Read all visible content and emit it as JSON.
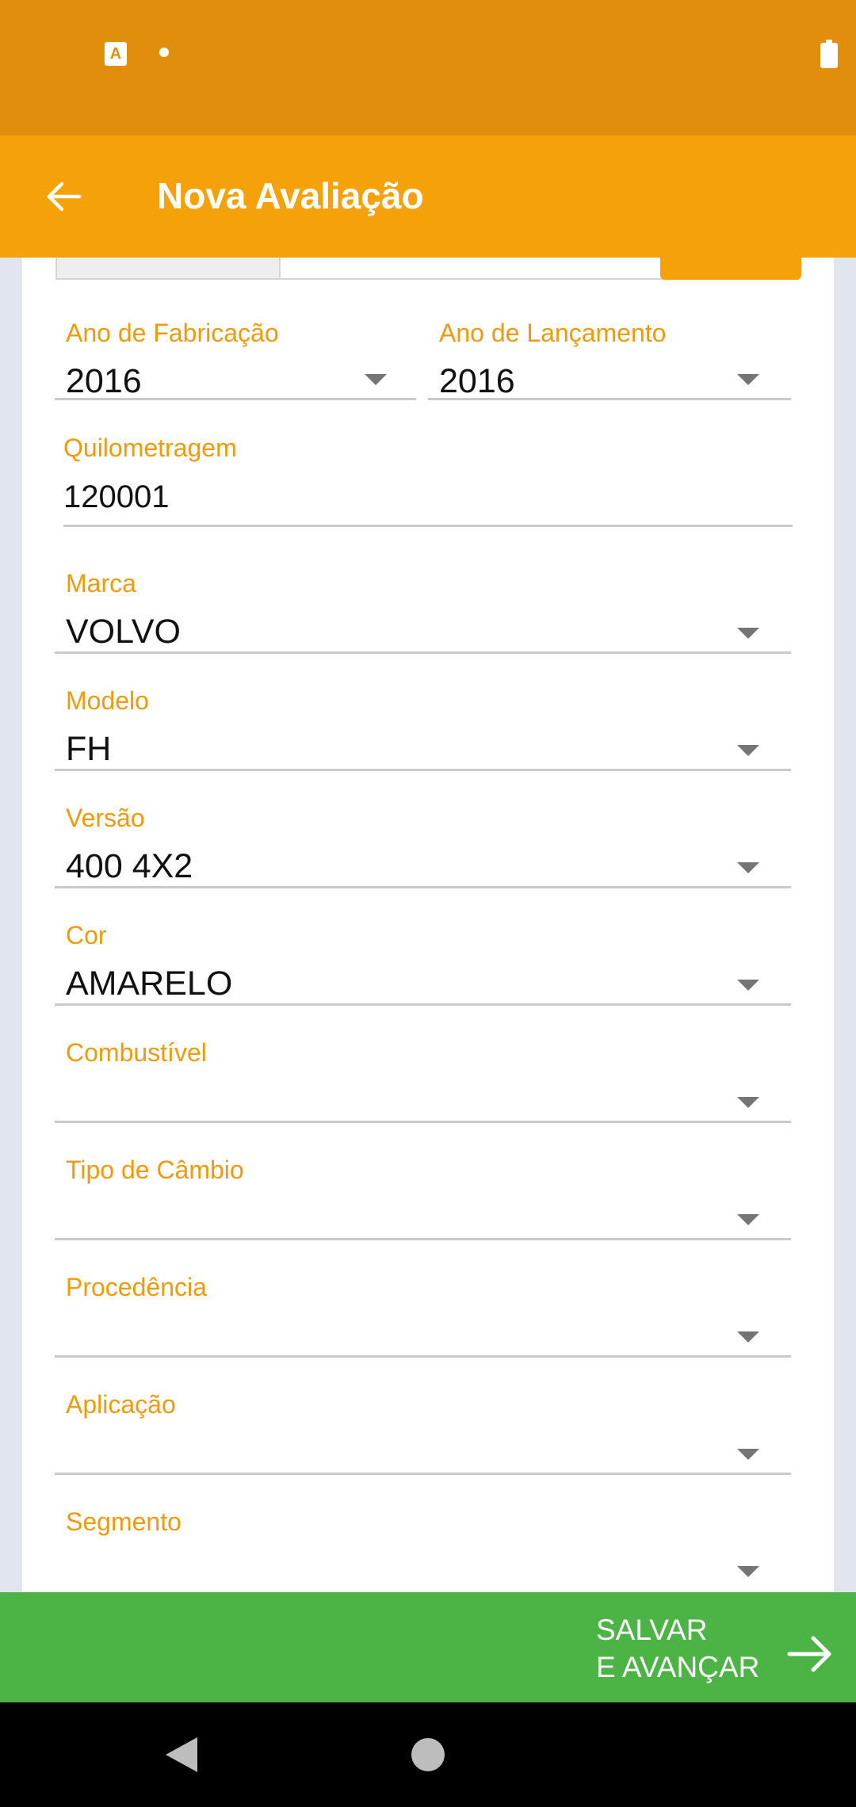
{
  "status_bar": {
    "notification_icon_letter": "A"
  },
  "app_bar": {
    "title": "Nova Avaliação"
  },
  "form": {
    "ano_fabricacao": {
      "label": "Ano de Fabricação",
      "value": "2016"
    },
    "ano_lancamento": {
      "label": "Ano de Lançamento",
      "value": "2016"
    },
    "quilometragem": {
      "label": "Quilometragem",
      "value": "120001"
    },
    "marca": {
      "label": "Marca",
      "value": "VOLVO"
    },
    "modelo": {
      "label": "Modelo",
      "value": "FH"
    },
    "versao": {
      "label": "Versão",
      "value": "400 4X2"
    },
    "cor": {
      "label": "Cor",
      "value": "AMARELO"
    },
    "combustivel": {
      "label": "Combustível",
      "value": ""
    },
    "tipo_cambio": {
      "label": "Tipo de Câmbio",
      "value": ""
    },
    "procedencia": {
      "label": "Procedência",
      "value": ""
    },
    "aplicacao": {
      "label": "Aplicação",
      "value": ""
    },
    "segmento": {
      "label": "Segmento",
      "value": ""
    }
  },
  "bottom_bar": {
    "save_line1": "SALVAR",
    "save_line2": "E AVANÇAR"
  },
  "colors": {
    "status_bar": "#e08e0b",
    "app_bar": "#f4a10a",
    "label": "#f09a0a",
    "save_bar": "#4cb444",
    "background": "#e1e6ec"
  },
  "icons": [
    "notification-a-icon",
    "dot-icon",
    "battery-icon",
    "back-arrow-icon",
    "dropdown-arrow-icon",
    "forward-arrow-icon",
    "nav-back-icon",
    "nav-home-icon"
  ]
}
